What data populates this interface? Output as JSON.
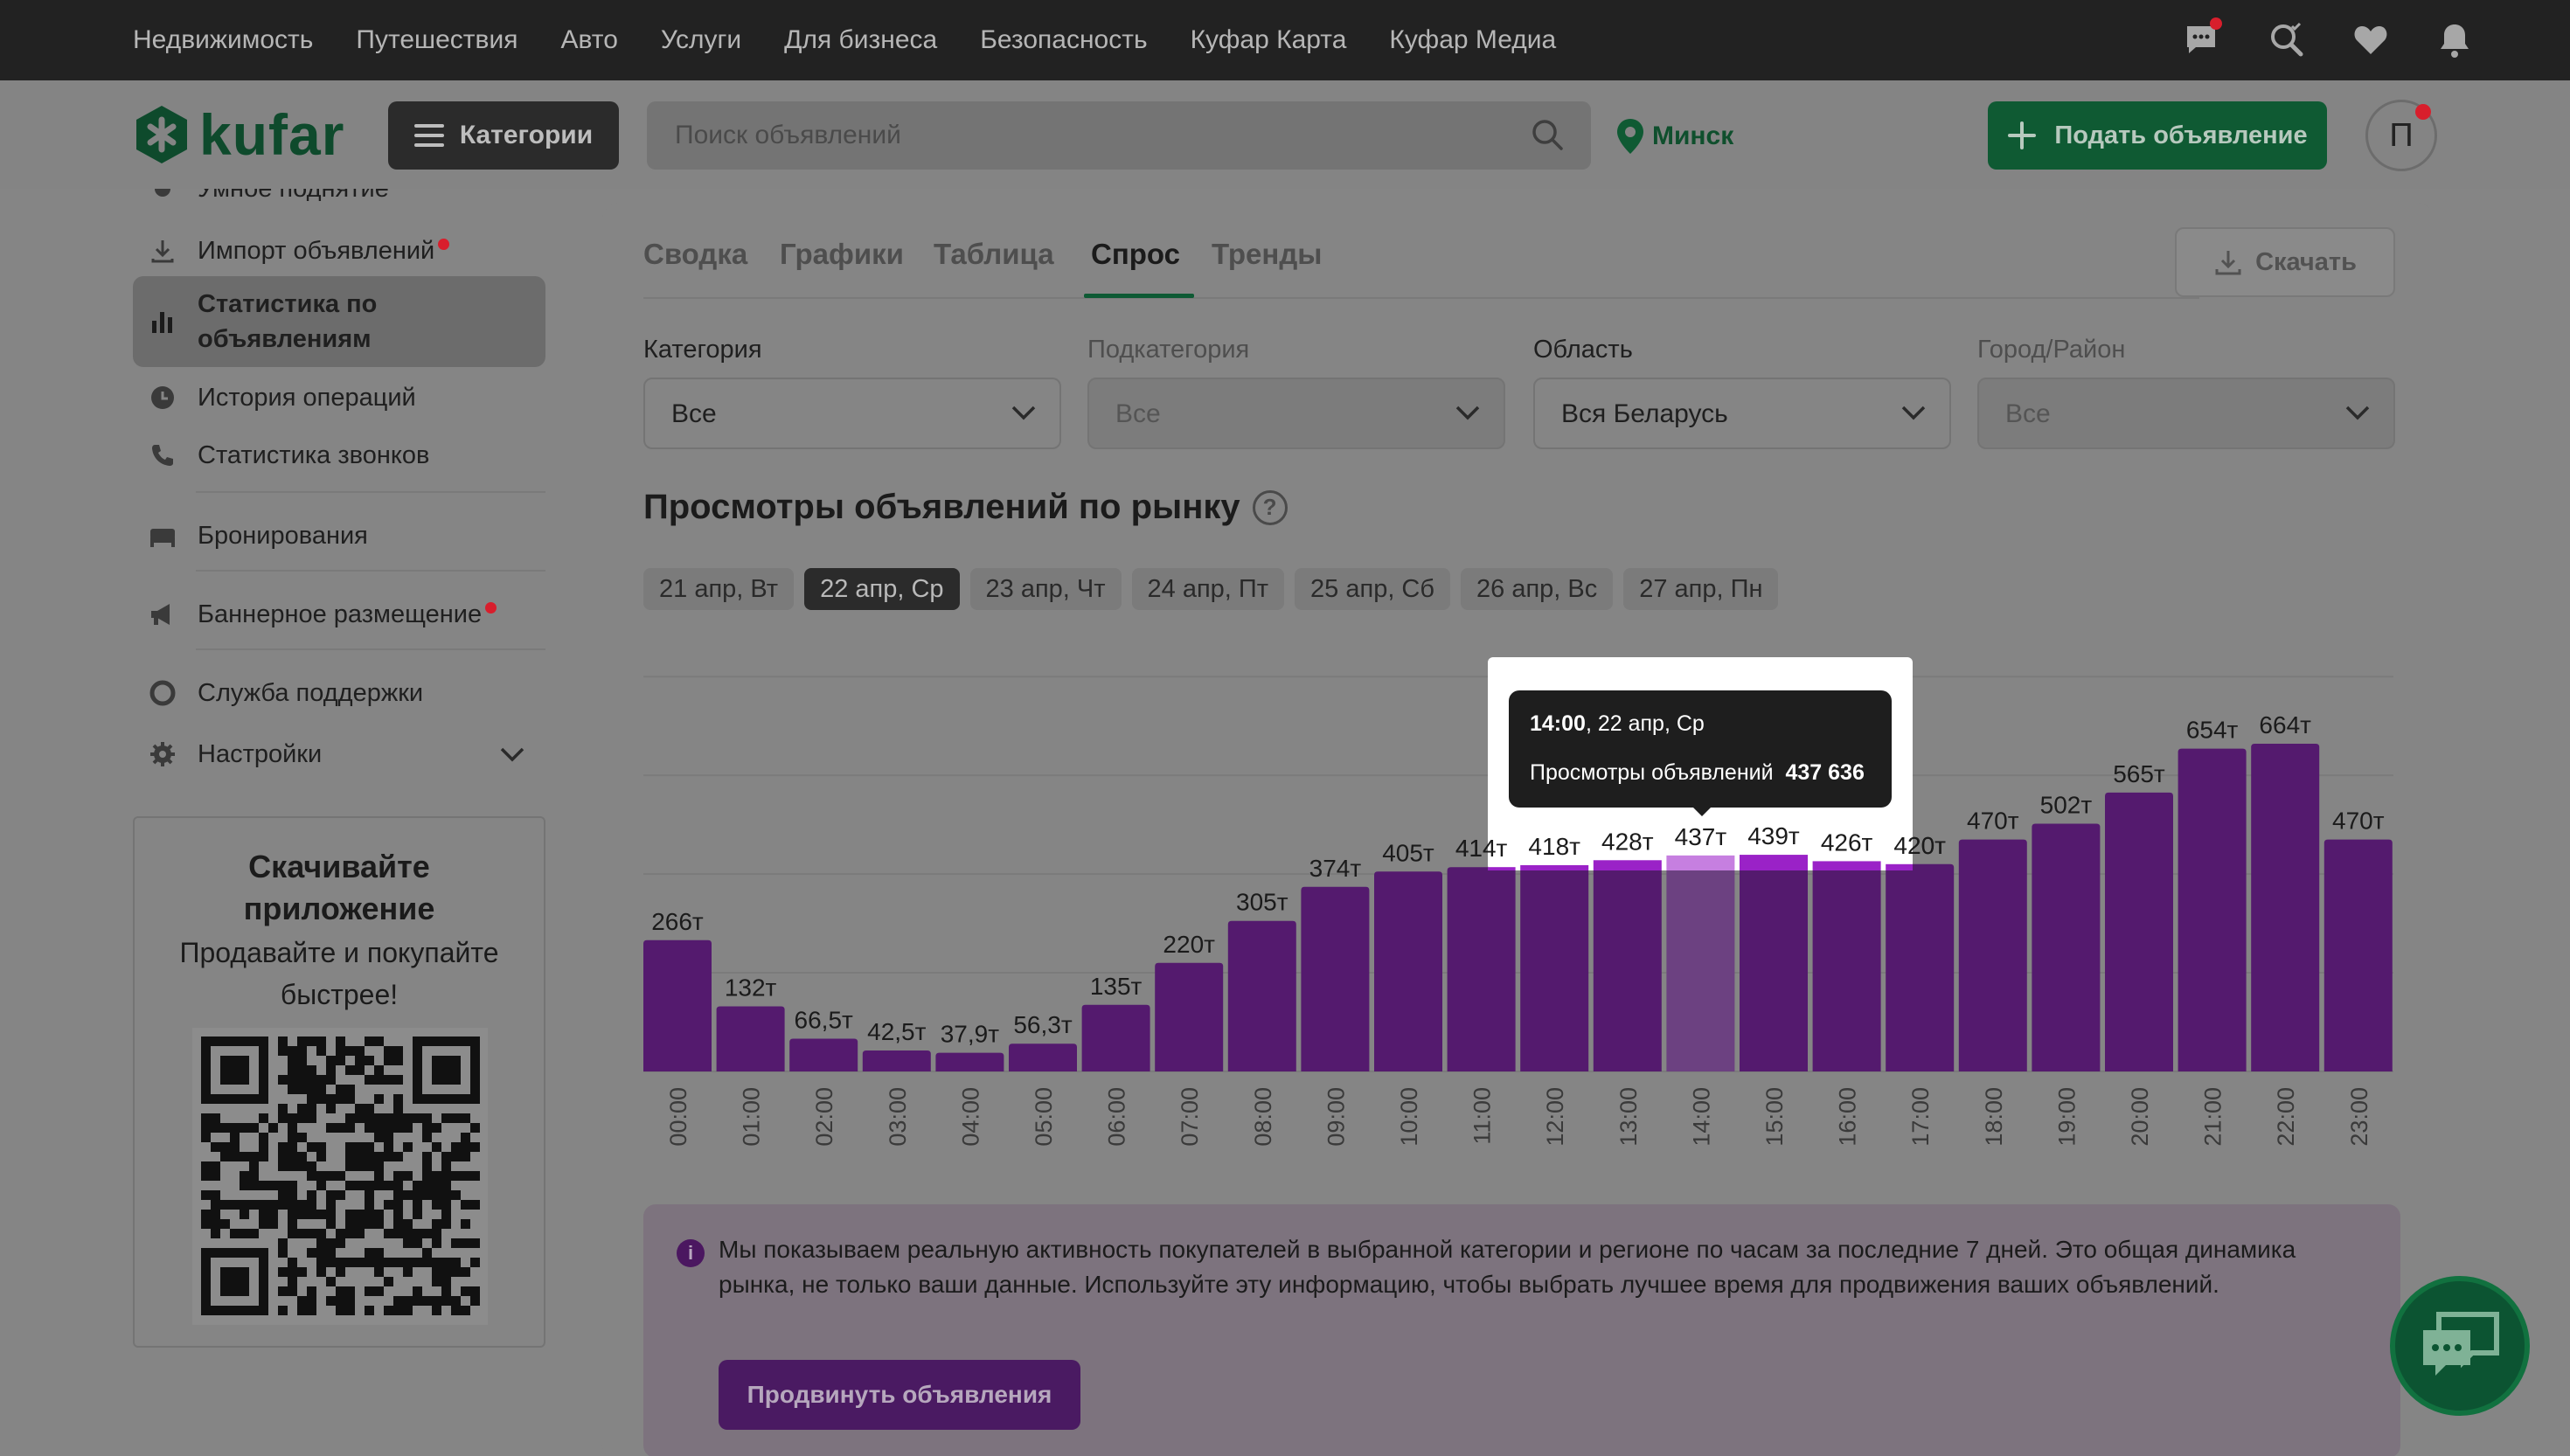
{
  "topnav": [
    "Недвижимость",
    "Путешествия",
    "Авто",
    "Услуги",
    "Для бизнеса",
    "Безопасность",
    "Куфар Карта",
    "Куфар Медиа"
  ],
  "header": {
    "logo": "kufar",
    "categories_label": "Категории",
    "search_placeholder": "Поиск объявлений",
    "city": "Минск",
    "post_label": "Подать объявление",
    "avatar_letter": "П"
  },
  "sidebar": {
    "partial_label": "Умное поднятие",
    "items": [
      {
        "label": "Импорт объявлений",
        "badge": true
      },
      {
        "label": "Статистика по объявлениям",
        "active": true
      },
      {
        "label": "История операций"
      },
      {
        "label": "Статистика звонков"
      },
      {
        "label": "Бронирования"
      },
      {
        "label": "Баннерное размещение",
        "badge": true
      },
      {
        "label": "Служба поддержки"
      },
      {
        "label": "Настройки"
      }
    ],
    "promo": {
      "title_line1": "Скачивайте",
      "title_line2": "приложение",
      "subtitle_line1": "Продавайте и покупайте",
      "subtitle_line2": "быстрее!"
    }
  },
  "tabs": [
    "Сводка",
    "Графики",
    "Таблица",
    "Спрос",
    "Тренды"
  ],
  "active_tab": "Спрос",
  "download_label": "Скачать",
  "filters": [
    {
      "label": "Категория",
      "value": "Все",
      "disabled": false
    },
    {
      "label": "Подкатегория",
      "value": "Все",
      "disabled": true
    },
    {
      "label": "Область",
      "value": "Вся Беларусь",
      "disabled": false
    },
    {
      "label": "Город/Район",
      "value": "Все",
      "disabled": true
    }
  ],
  "section_title": "Просмотры объявлений по рынку",
  "help_glyph": "?",
  "day_chips": [
    "21 апр, Вт",
    "22 апр, Ср",
    "23 апр, Чт",
    "24 апр, Пт",
    "25 апр, Сб",
    "26 апр, Вс",
    "27 апр, Пн"
  ],
  "active_chip": "22 апр, Ср",
  "chart_data": {
    "type": "bar",
    "categories": [
      "00:00",
      "01:00",
      "02:00",
      "03:00",
      "04:00",
      "05:00",
      "06:00",
      "07:00",
      "08:00",
      "09:00",
      "10:00",
      "11:00",
      "12:00",
      "13:00",
      "14:00",
      "15:00",
      "16:00",
      "17:00",
      "18:00",
      "19:00",
      "20:00",
      "21:00",
      "22:00",
      "23:00"
    ],
    "values": [
      266000,
      132000,
      66500,
      42500,
      37900,
      56300,
      135000,
      220000,
      305000,
      374000,
      405000,
      414000,
      418000,
      428000,
      437636,
      439000,
      426000,
      420000,
      470000,
      502000,
      565000,
      654000,
      664000,
      470000
    ],
    "data_labels": [
      "266т",
      "132т",
      "66,5т",
      "42,5т",
      "37,9т",
      "56,3т",
      "135т",
      "220т",
      "305т",
      "374т",
      "405т",
      "414т",
      "418т",
      "428т",
      "437т",
      "439т",
      "426т",
      "420т",
      "470т",
      "502т",
      "565т",
      "654т",
      "664т",
      "470т"
    ],
    "ylim": [
      0,
      800000
    ],
    "grid": true,
    "highlight_index": 14,
    "bar_color": "#541a6e",
    "highlight_color": "#6c4181"
  },
  "tooltip": {
    "time": "14:00",
    "date": ", 22 апр, Ср",
    "metric_label": "Просмотры объявлений",
    "metric_value": "437 636"
  },
  "info": {
    "text": "Мы показываем реальную активность покупателей в выбранной категории и регионе по часам за последние 7 дней. Это общая динамика рынка, не только ваши данные. Используйте эту информацию, чтобы выбрать лучшее время для продвижения ваших объявлений.",
    "button": "Продвинуть объявления"
  }
}
